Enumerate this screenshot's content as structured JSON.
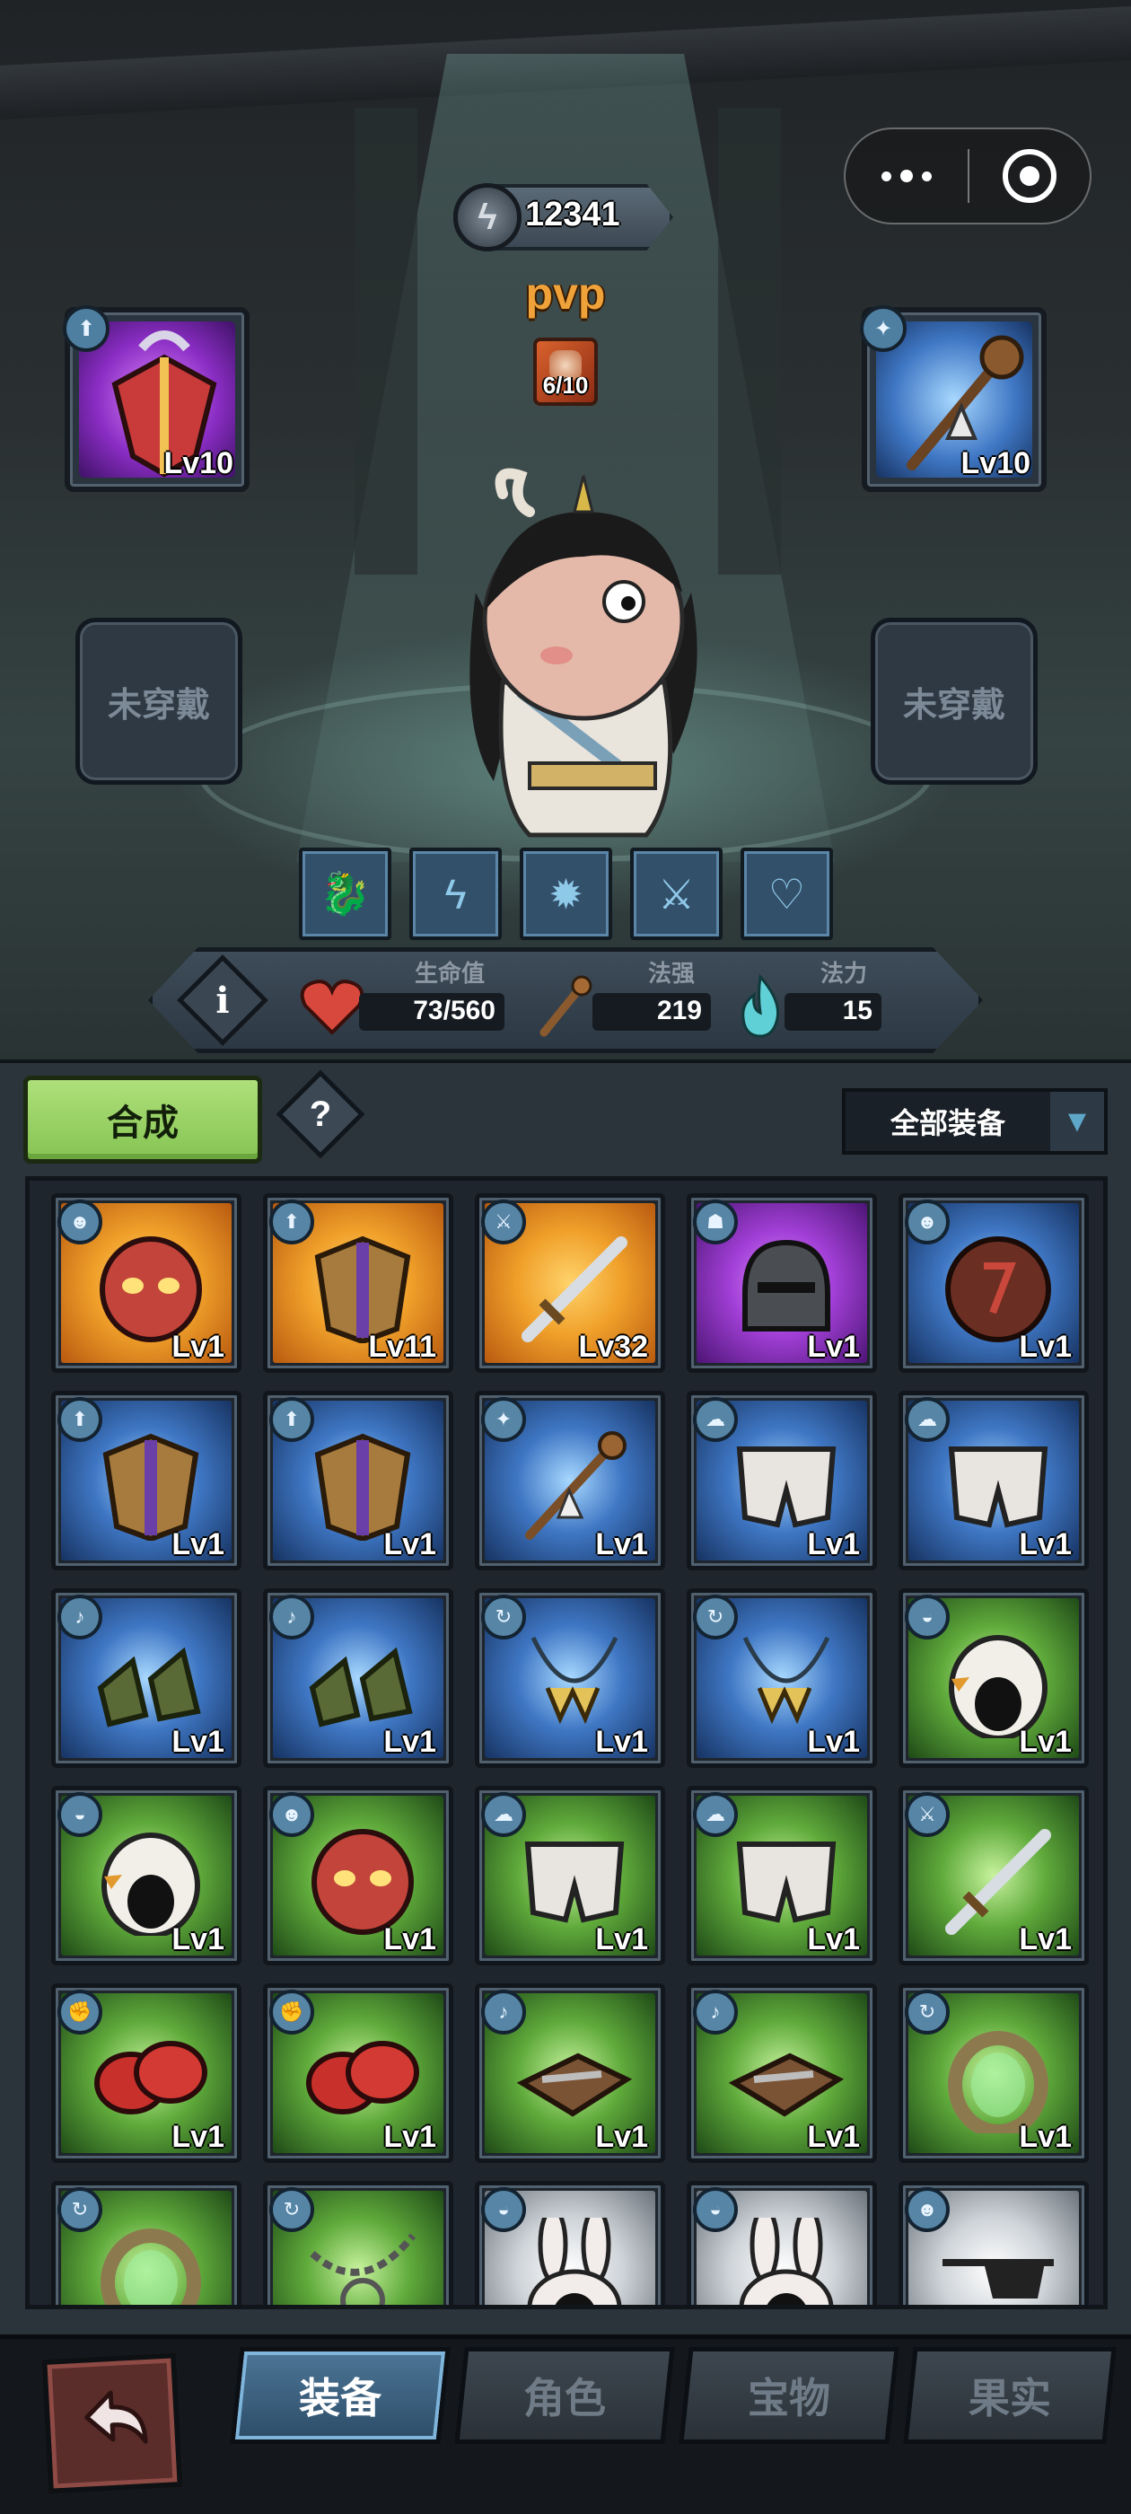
{
  "capsule": {
    "more_icon": "more-dots-icon",
    "close_icon": "target-close-icon"
  },
  "header": {
    "currency_value": "12341",
    "mode": "pvp",
    "pvp_tickets": "6/10"
  },
  "equipped": {
    "left_top": {
      "level": "Lv10",
      "type": "armor",
      "rarity": "purple"
    },
    "right_top": {
      "level": "Lv10",
      "type": "staff",
      "rarity": "blue"
    },
    "left_empty": "未穿戴",
    "right_empty": "未穿戴"
  },
  "skills": [
    "dragon-skill-icon",
    "lightning-skill-icon",
    "fire-skill-icon",
    "summon-skill-icon",
    "heart-skill-icon"
  ],
  "stats": {
    "hp_label": "生命值",
    "hp_value": "73/560",
    "power_label": "法强",
    "power_value": "219",
    "mana_label": "法力",
    "mana_value": "15"
  },
  "inventory": {
    "compose_label": "合成",
    "help_label": "?",
    "filter_label": "全部装备",
    "items": [
      {
        "level": "Lv1",
        "rarity": "orange",
        "kind": "mask"
      },
      {
        "level": "Lv11",
        "rarity": "orange",
        "kind": "armor"
      },
      {
        "level": "Lv32",
        "rarity": "orange",
        "kind": "sword"
      },
      {
        "level": "Lv1",
        "rarity": "purple",
        "kind": "helmet"
      },
      {
        "level": "Lv1",
        "rarity": "blue",
        "kind": "shield-round"
      },
      {
        "level": "Lv1",
        "rarity": "blue",
        "kind": "armor"
      },
      {
        "level": "Lv1",
        "rarity": "blue",
        "kind": "armor"
      },
      {
        "level": "Lv1",
        "rarity": "blue",
        "kind": "staff"
      },
      {
        "level": "Lv1",
        "rarity": "blue",
        "kind": "pants"
      },
      {
        "level": "Lv1",
        "rarity": "blue",
        "kind": "pants"
      },
      {
        "level": "Lv1",
        "rarity": "blue",
        "kind": "boots"
      },
      {
        "level": "Lv1",
        "rarity": "blue",
        "kind": "boots"
      },
      {
        "level": "Lv1",
        "rarity": "blue",
        "kind": "necklace"
      },
      {
        "level": "Lv1",
        "rarity": "blue",
        "kind": "necklace"
      },
      {
        "level": "Lv1",
        "rarity": "green",
        "kind": "chicken-hat"
      },
      {
        "level": "Lv1",
        "rarity": "green",
        "kind": "chicken-hat"
      },
      {
        "level": "Lv1",
        "rarity": "green",
        "kind": "mask"
      },
      {
        "level": "Lv1",
        "rarity": "green",
        "kind": "pants"
      },
      {
        "level": "Lv1",
        "rarity": "green",
        "kind": "pants"
      },
      {
        "level": "Lv1",
        "rarity": "green",
        "kind": "sword"
      },
      {
        "level": "Lv1",
        "rarity": "green",
        "kind": "gloves"
      },
      {
        "level": "Lv1",
        "rarity": "green",
        "kind": "gloves"
      },
      {
        "level": "Lv1",
        "rarity": "green",
        "kind": "sandals"
      },
      {
        "level": "Lv1",
        "rarity": "green",
        "kind": "sandals"
      },
      {
        "level": "Lv1",
        "rarity": "green",
        "kind": "ring"
      },
      {
        "level": "",
        "rarity": "green",
        "kind": "ring"
      },
      {
        "level": "",
        "rarity": "green",
        "kind": "chain"
      },
      {
        "level": "",
        "rarity": "white",
        "kind": "bunny-hat"
      },
      {
        "level": "",
        "rarity": "white",
        "kind": "bunny-hat"
      },
      {
        "level": "",
        "rarity": "white",
        "kind": "eyepatch"
      }
    ]
  },
  "nav": {
    "back_icon": "back-arrow-icon",
    "tabs": [
      "装备",
      "角色",
      "宝物",
      "果实"
    ],
    "active": 0
  },
  "colors": {
    "orange": "#f0a02a",
    "purple": "#a13fd6",
    "blue": "#3f77c4",
    "green": "#5faa3b",
    "white": "#cfd4d9",
    "accent_green": "#86c453",
    "pvp_gold": "#f0a23a"
  }
}
